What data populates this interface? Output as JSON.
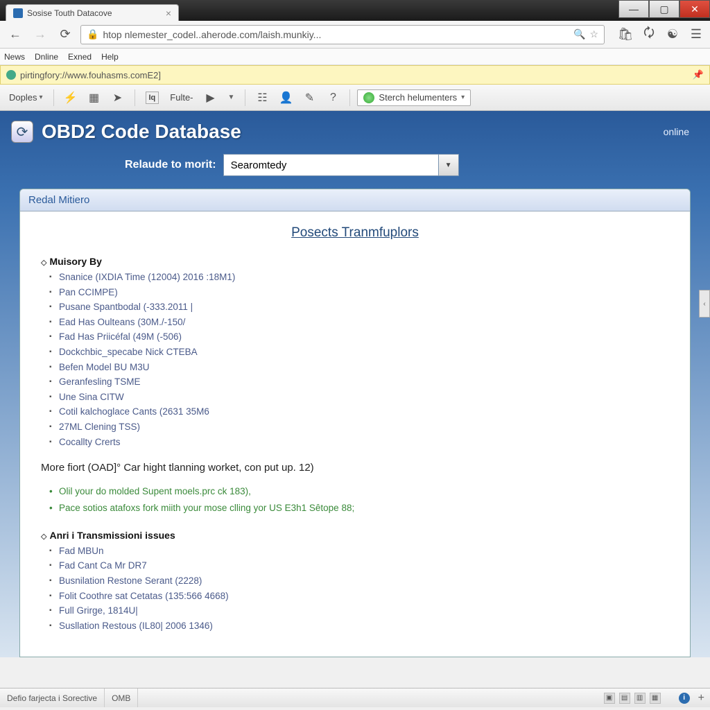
{
  "window": {
    "tab_title": "Sosise Touth Datacove"
  },
  "nav": {
    "url": "htop nlemester_codel..aherode.com/laish.munkiy..."
  },
  "menu": [
    "News",
    "Dnline",
    "Exned",
    "Help"
  ],
  "info_bar": {
    "text": "pirtingfory://www.fouhasms.comE2]"
  },
  "toolbar": {
    "doples": "Doples",
    "fulte": "Fulte-",
    "search_label": "Sterch helumenters"
  },
  "page": {
    "title": "OBD2 Code Database",
    "online": "online",
    "search_label": "Relaude to morit:",
    "search_value": "Searomtedy",
    "panel_head": "Redal Mitiero",
    "main_heading": "Posects Tranmfuplors",
    "section1": {
      "title": "Muisory By",
      "items": [
        "Snanice (IXDIA Time (12004) 2016 :18M1)",
        "Pan CCIMPE)",
        "Pusane Spantbodal (-333.2011 |",
        "Ead Has Oulteans (30M./-150/",
        "Fad Has Priicéfal (49M (-506)",
        "Dockchbic_specabe Nick CTEBA",
        "Befen Model BU M3U",
        "Geranfesling TSME",
        "Une Sina CITW",
        "Cotil kalchoglace Cants (2631 35M6",
        "27ML Clening TSS)",
        "Cocallty Crerts"
      ]
    },
    "note": "More fiort (OAD]° Car hight tlanning worket, con put up. 12)",
    "green_items": [
      "Olil your do molded Supent moels.prc ck 183),",
      "Pace sotios atafoxs fork miith your mose clling yor US E3h1 Sêtope 88;"
    ],
    "section2": {
      "title": "Anri i Transmissioni issues",
      "items": [
        "Fad MBUn",
        "Fad Cant Ca Mr DR7",
        "Busnilation Restone Serant (2228)",
        "Folit Coothre sat Cetatas (135:566 4668)",
        "Full Grirge, 1814U|",
        "Susllation Restous (IL80| 2006 1346)"
      ]
    }
  },
  "status": {
    "left": "Defio farjecta i Sorective",
    "mid": "OMB",
    "plus": "+"
  }
}
